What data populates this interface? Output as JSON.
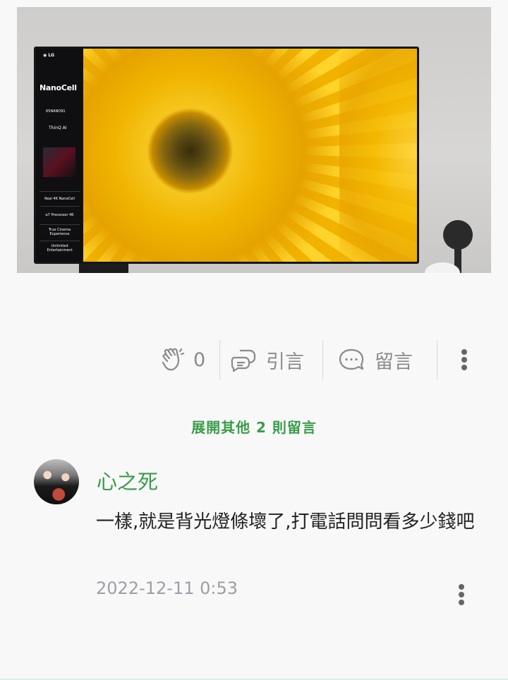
{
  "photo": {
    "tv_logo": "◉ LG",
    "tv_brand": "NanoCell",
    "tv_model": "65NANO91",
    "tv_thinq": "ThinQ AI",
    "tv_features": [
      "Real 4K NanoCell",
      "α7 Processor 4K",
      "True Cinema Experience",
      "Unlimited Entertainment"
    ]
  },
  "actions": {
    "clap_count": "0",
    "quote_label": "引言",
    "comment_label": "留言",
    "icons": [
      "clap-icon",
      "quote-icon",
      "comment-icon",
      "more-icon"
    ]
  },
  "comments": {
    "expand_label": "展開其他 2 則留言",
    "items": [
      {
        "author": "心之死",
        "text": "一樣,就是背光燈條壞了,打電話問問看多少錢吧",
        "timestamp": "2022-12-11 0:53"
      }
    ]
  },
  "colors": {
    "accent": "#3a9c4a",
    "muted": "#8a8a8a",
    "timestamp": "#9aa0a6"
  }
}
